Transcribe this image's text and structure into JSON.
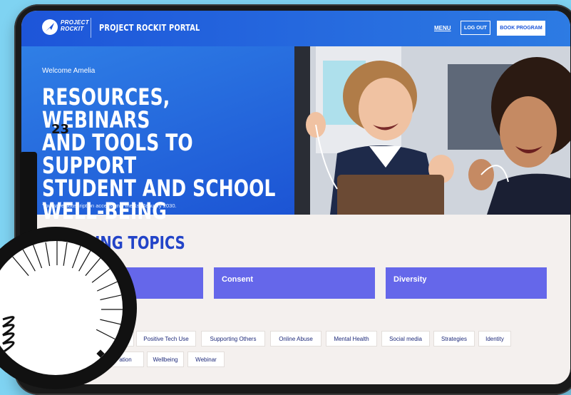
{
  "header": {
    "logo_line1": "PROJECT",
    "logo_line2": "ROCKIT",
    "portal_title": "PROJECT ROCKIT PORTAL",
    "menu_label": "MENU",
    "logout_label": "LOG OUT",
    "book_label": "BOOK PROGRAM"
  },
  "hero": {
    "welcome": "Welcome Amelia",
    "heading_lines": [
      "RESOURCES, WEBINARS",
      "AND TOOLS TO SUPPORT",
      "STUDENT AND SCHOOL",
      "WELL-BEING"
    ],
    "subscription_note": "You have subscription access until the 1st January 2030."
  },
  "trending": {
    "title": "TRENDING TOPICS",
    "cards": [
      {
        "label": ""
      },
      {
        "label": "Consent"
      },
      {
        "label": "Diversity"
      }
    ],
    "tags_row1": [
      "ion",
      "Positive Tech Use",
      "Supporting Others",
      "Online Abuse",
      "Mental Health",
      "Social media",
      "Strategies",
      "Identity"
    ],
    "tags_row2": [
      "ation",
      "Wellbeing",
      "Webinar"
    ]
  },
  "sticker": {
    "number": "23"
  },
  "colors": {
    "brand_blue": "#1d55d9",
    "card_purple": "#6567ea",
    "heading_blue": "#2344c8",
    "page_bg": "#f4f0ee"
  }
}
